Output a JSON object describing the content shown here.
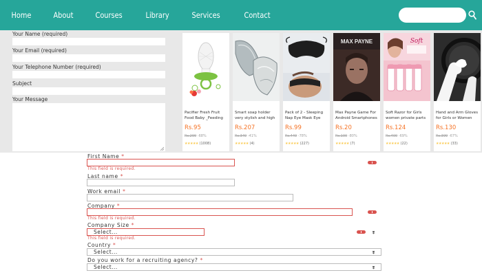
{
  "nav": {
    "links": [
      "Home",
      "About",
      "Courses",
      "Library",
      "Services",
      "Contact"
    ],
    "search_placeholder": ""
  },
  "contact_form": {
    "name_label": "Your Name (required)",
    "email_label": "Your Email (required)",
    "phone_label": "Your Telephone Number (required)",
    "subject_label": "Subject",
    "message_label": "Your Message"
  },
  "products": [
    {
      "title": "Pacifier Fresh Fruit Food Baby _Feeding Safe Fruit...",
      "price": "Rs.95",
      "old_price": "Rs.299",
      "discount": "-68%",
      "rating_count": "(1008)"
    },
    {
      "title": "Smart soap holder very stylish and high quality lea...",
      "price": "Rs.207",
      "old_price": "Rs.349",
      "discount": "-41%",
      "rating_count": "(4)"
    },
    {
      "title": "Pack of 2 - Sleeping Nap Eye Mask Eye Shade Cove...",
      "price": "Rs.99",
      "old_price": "Rs.449",
      "discount": "-78%",
      "rating_count": "(227)"
    },
    {
      "title": "Max Payne Game For Android Smartphones -...",
      "price": "Rs.20",
      "old_price": "Rs.100",
      "discount": "-80%",
      "rating_count": "(7)"
    },
    {
      "title": "Soft Razor for Girls women private parts pack of 6",
      "price": "Rs.124",
      "old_price": "Rs.400",
      "discount": "-69%",
      "rating_count": "(22)"
    },
    {
      "title": "Hand and Arm Gloves for Girls or Women (Muslim...",
      "price": "Rs.130",
      "old_price": "Rs.399",
      "discount": "-67%",
      "rating_count": "(33)"
    }
  ],
  "product_image_text": {
    "max_payne": "MAX PAYNE",
    "razor": "Soft"
  },
  "lower_form": {
    "first_name_label": "First Name",
    "last_name_label": "Last name",
    "work_email_label": "Work email",
    "company_label": "Company",
    "company_size_label": "Company Size",
    "country_label": "Country",
    "recruiting_label": "Do you work for a recruiting agency?",
    "required_mark": "*",
    "error_text": "This field is required.",
    "select_placeholder": "Select..."
  },
  "colors": {
    "nav_bg": "#26a69a",
    "error": "#d9534f",
    "price": "#f57224",
    "star": "#faca51"
  }
}
